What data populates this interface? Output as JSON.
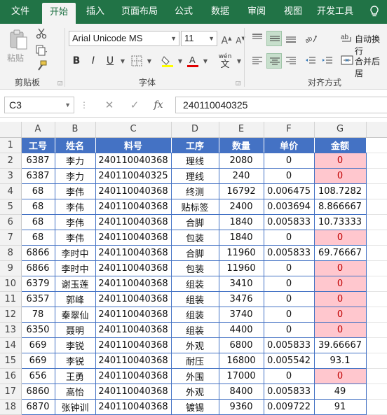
{
  "tabs": [
    "文件",
    "开始",
    "插入",
    "页面布局",
    "公式",
    "数据",
    "审阅",
    "视图",
    "开发工具"
  ],
  "active_tab": "开始",
  "colors": {
    "brand": "#217346",
    "header_fill": "#4472c4",
    "highlight_fill": "#ffc7ce",
    "highlight_text": "#c00000"
  },
  "ribbon": {
    "clipboard_label": "剪贴板",
    "paste_label": "粘贴",
    "font_label": "字体",
    "alignment_label": "对齐方式",
    "font_name": "Arial Unicode MS",
    "font_size": "11",
    "wrap_text_label": "自动换行",
    "merge_center_label": "合并后居",
    "phonetic_glyph": "wén",
    "phonetic_char": "文",
    "bold": "B",
    "italic": "I",
    "underline": "U"
  },
  "formula_bar": {
    "name_box": "C3",
    "fx": "fx",
    "value": "240110040325"
  },
  "columns": [
    "A",
    "B",
    "C",
    "D",
    "E",
    "F",
    "G"
  ],
  "rows": [
    [
      "工号",
      "姓名",
      "料号",
      "工序",
      "数量",
      "单价",
      "金额"
    ],
    [
      "6387",
      "李力",
      "240110040368",
      "理线",
      "2080",
      "0",
      "0"
    ],
    [
      "6387",
      "李力",
      "240110040325",
      "理线",
      "240",
      "0",
      "0"
    ],
    [
      "68",
      "李伟",
      "240110040368",
      "终测",
      "16792",
      "0.006475",
      "108.7282"
    ],
    [
      "68",
      "李伟",
      "240110040368",
      "贴标签",
      "2400",
      "0.003694",
      "8.866667"
    ],
    [
      "68",
      "李伟",
      "240110040368",
      "合脚",
      "1840",
      "0.005833",
      "10.73333"
    ],
    [
      "68",
      "李伟",
      "240110040368",
      "包装",
      "1840",
      "0",
      "0"
    ],
    [
      "6866",
      "李时中",
      "240110040368",
      "合脚",
      "11960",
      "0.005833",
      "69.76667"
    ],
    [
      "6866",
      "李时中",
      "240110040368",
      "包装",
      "11960",
      "0",
      "0"
    ],
    [
      "6379",
      "谢玉莲",
      "240110040368",
      "组装",
      "3410",
      "0",
      "0"
    ],
    [
      "6357",
      "郭峰",
      "240110040368",
      "组装",
      "3476",
      "0",
      "0"
    ],
    [
      "78",
      "秦翠仙",
      "240110040368",
      "组装",
      "3740",
      "0",
      "0"
    ],
    [
      "6350",
      "聂明",
      "240110040368",
      "组装",
      "4400",
      "0",
      "0"
    ],
    [
      "669",
      "李锐",
      "240110040368",
      "外观",
      "6800",
      "0.005833",
      "39.66667"
    ],
    [
      "669",
      "李锐",
      "240110040368",
      "耐压",
      "16800",
      "0.005542",
      "93.1"
    ],
    [
      "656",
      "王勇",
      "240110040368",
      "外围",
      "17000",
      "0",
      "0"
    ],
    [
      "6860",
      "高怡",
      "240110040368",
      "外观",
      "8400",
      "0.005833",
      "49"
    ],
    [
      "6870",
      "张钟训",
      "240110040368",
      "镀锡",
      "9360",
      "0.009722",
      "91"
    ]
  ]
}
